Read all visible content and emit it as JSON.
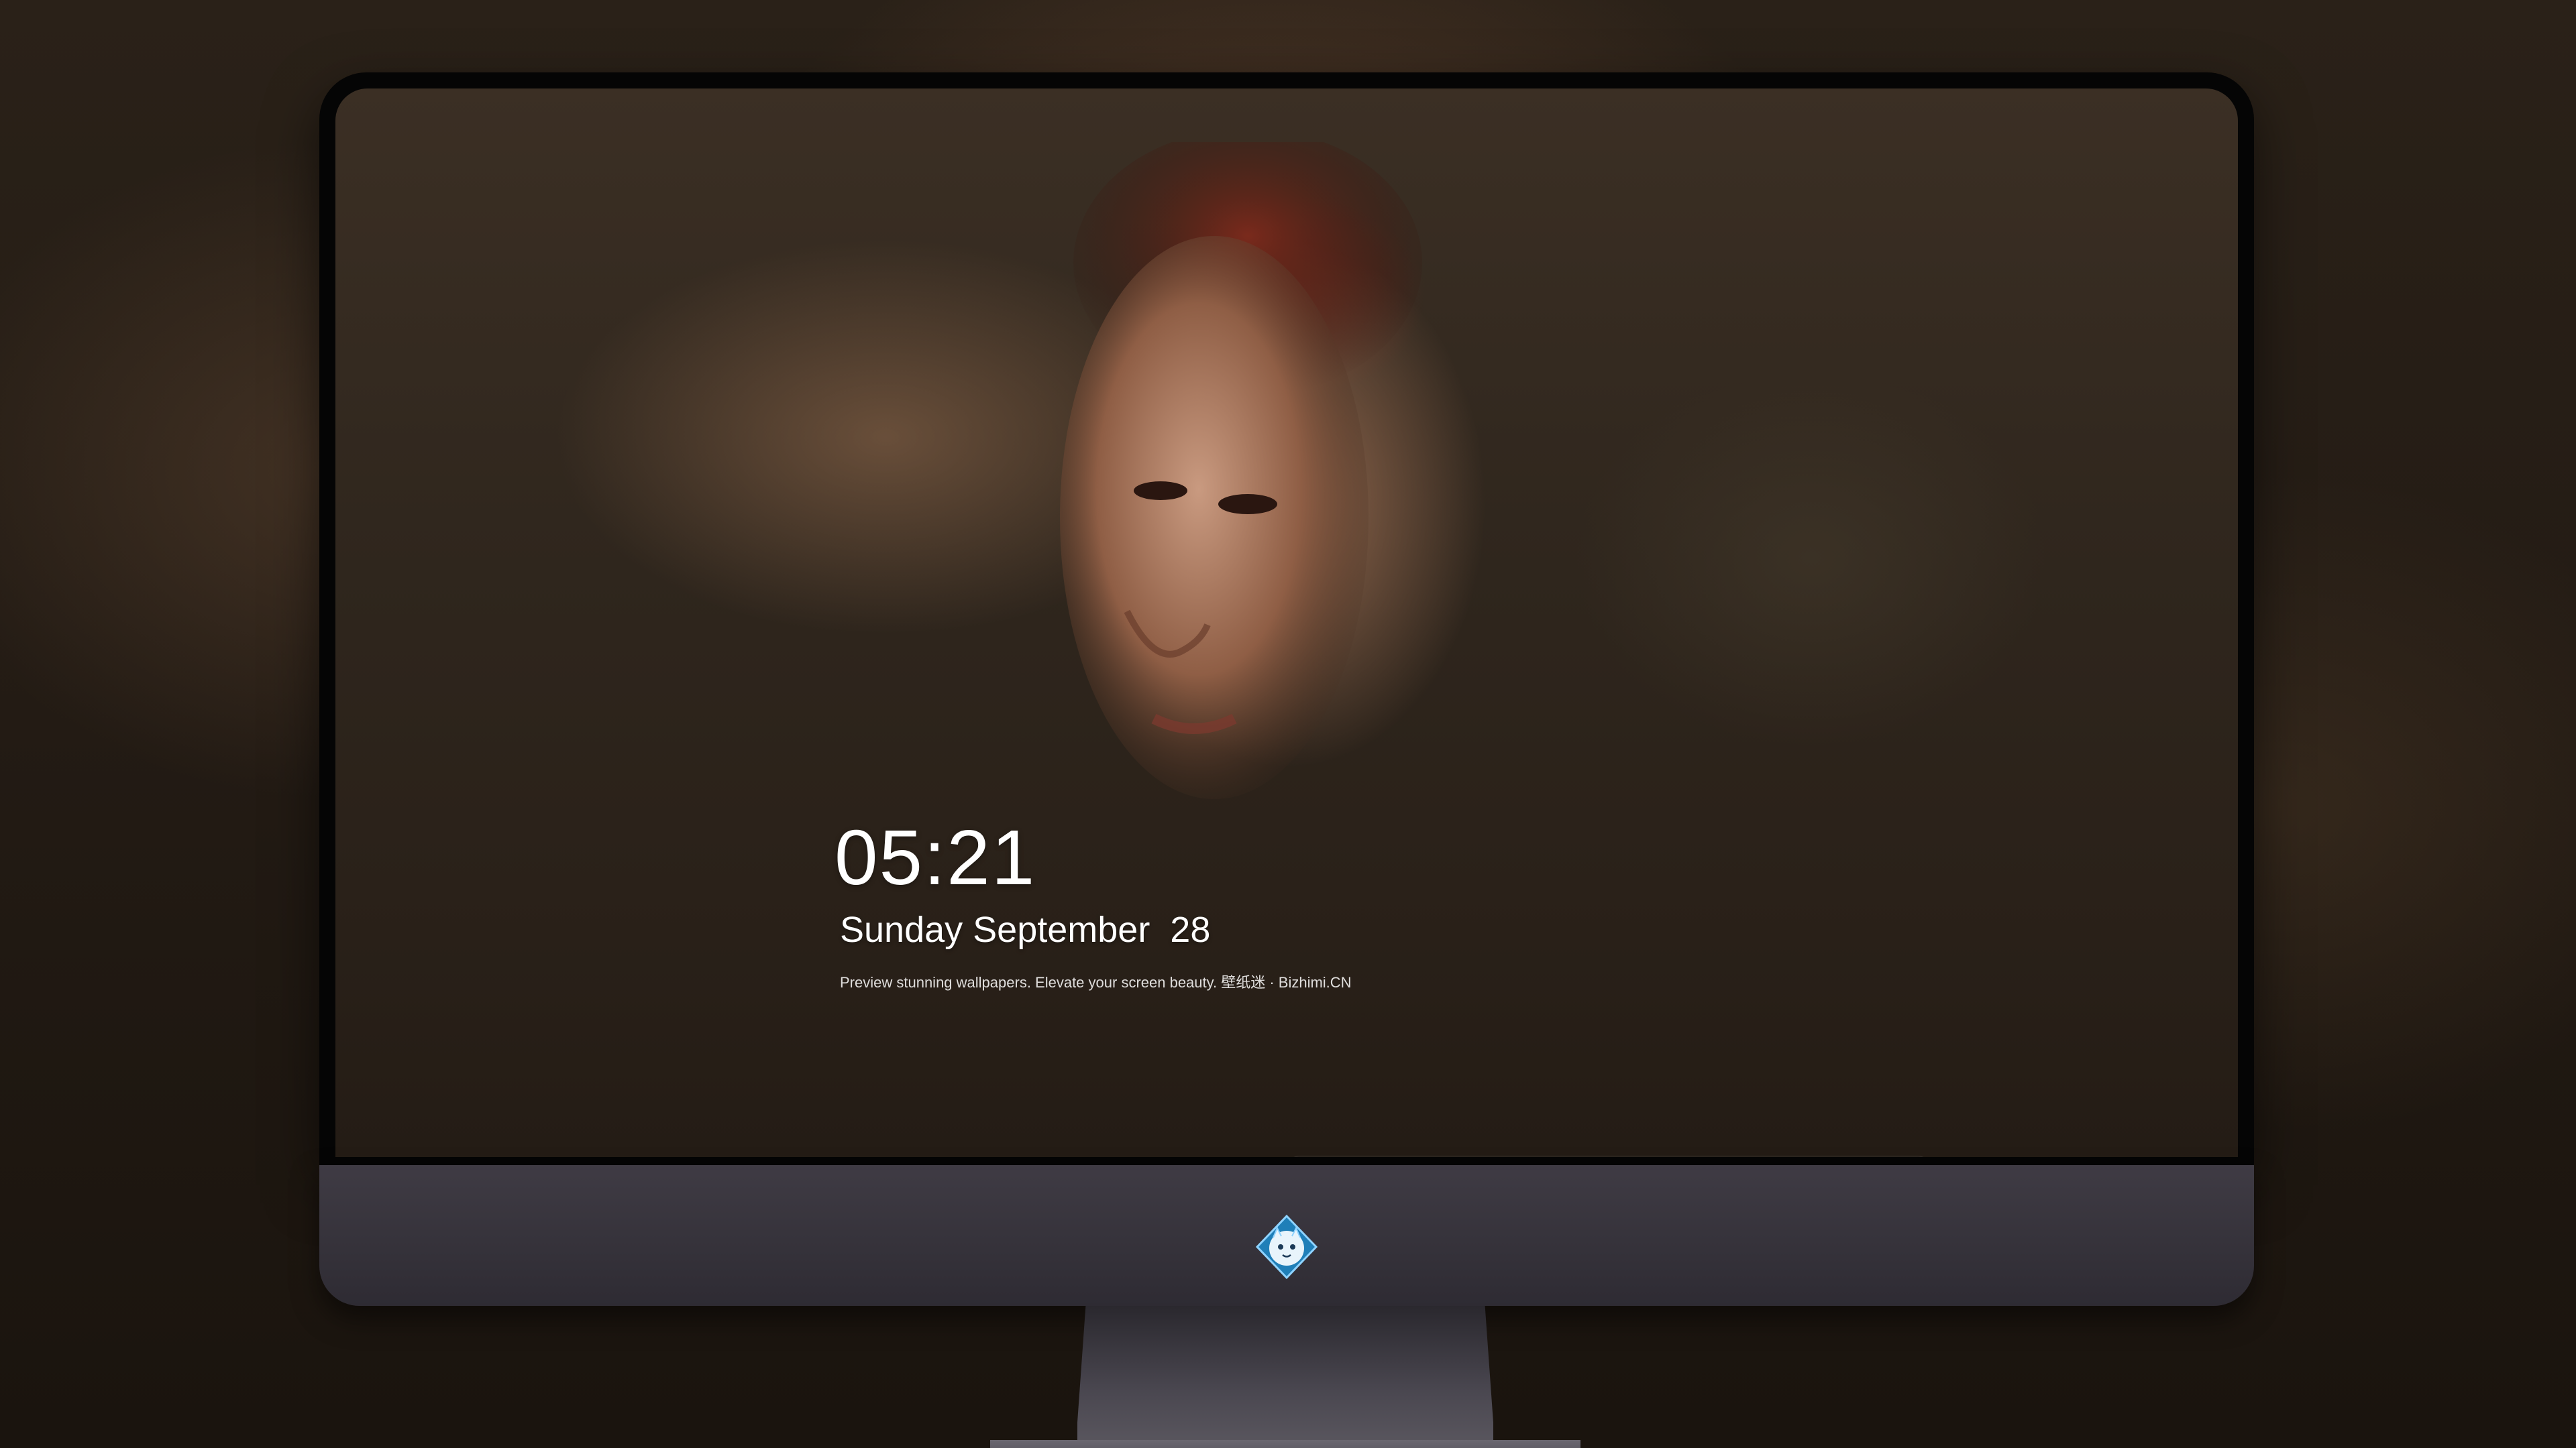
{
  "lockscreen": {
    "time": "05:21",
    "date": "Sunday September  28",
    "tagline": "Preview stunning wallpapers. Elevate your screen beauty. 壁纸迷 · Bizhimi.CN"
  },
  "dock": {
    "apps": [
      {
        "name": "messages-icon",
        "color": "#34c759"
      },
      {
        "name": "weather-icon",
        "color": "#1e88e5"
      },
      {
        "name": "clock-icon",
        "color": "#1b1b1b"
      },
      {
        "name": "preview-icon",
        "color": "#f2f2f2"
      },
      {
        "name": "clips-icon",
        "color": "#4fc3f7"
      },
      {
        "name": "notes-icon",
        "color": "#ffffff"
      },
      {
        "name": "photos-grid-icon",
        "color": "#e8e8e8"
      },
      {
        "name": "music-icon",
        "color": "#d04de0"
      },
      {
        "name": "app-store-icon",
        "color": "#1a8cff"
      },
      {
        "name": "camera-icon",
        "color": "#5a5a5a"
      }
    ]
  },
  "monitor": {
    "logo": "mascot-logo-icon"
  }
}
